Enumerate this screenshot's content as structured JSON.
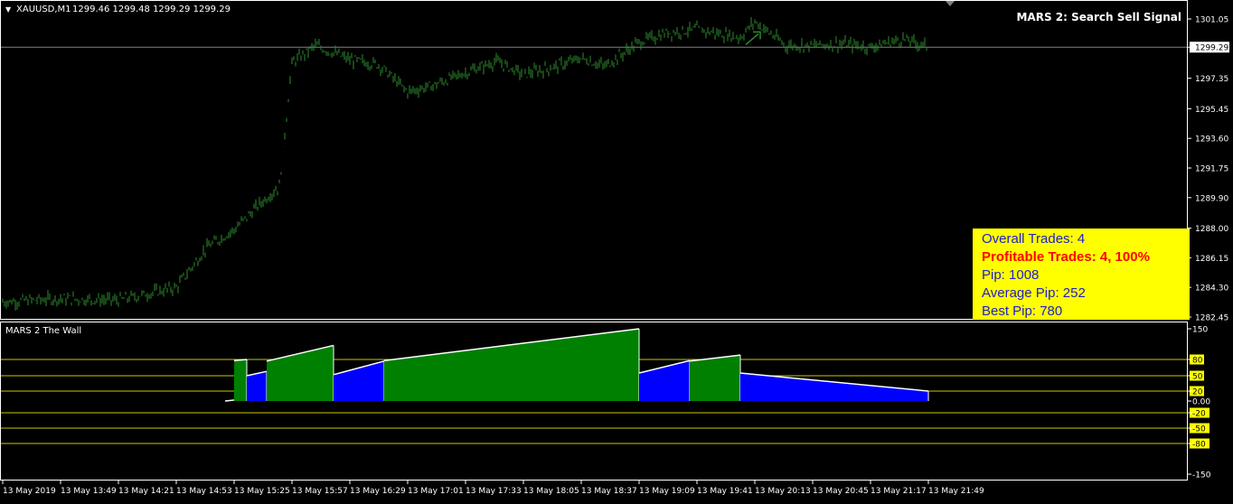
{
  "header": {
    "symbol": "XAUUSD,M1",
    "ohlc": "1299.46 1299.48 1299.29 1299.29",
    "signal_title": "MARS 2: Search Sell Signal",
    "current_price_label": "1299.29"
  },
  "info_box": {
    "lines": [
      {
        "text": "Overall Trades: 4",
        "highlight": false
      },
      {
        "text": "Profitable Trades: 4, 100%",
        "highlight": true
      },
      {
        "text": "Pip: 1008",
        "highlight": false
      },
      {
        "text": "Average Pip: 252",
        "highlight": false
      },
      {
        "text": "Best Pip: 780",
        "highlight": false
      }
    ],
    "background": "#ffff00",
    "text_color": "#2020c8",
    "highlight_color": "#ff0000"
  },
  "indicator": {
    "name": "MARS 2 The Wall"
  },
  "colors": {
    "price_line": "#2e8b2e",
    "histogram_green": "#008000",
    "histogram_blue": "#0000ff",
    "level_line": "#c8c800",
    "level_label_bg": "#ffff00",
    "current_price_line": "#808080"
  },
  "chart_data": [
    {
      "type": "line",
      "title": "",
      "xlabel": "",
      "ylabel": "",
      "ylim": [
        1282.45,
        1301.05
      ],
      "y_ticks": [
        "1301.05",
        "1299.29",
        "1297.35",
        "1295.45",
        "1293.60",
        "1291.75",
        "1289.90",
        "1288.00",
        "1286.15",
        "1284.30",
        "1282.45"
      ],
      "x_ticks": [
        "13 May 2019",
        "13 May 13:49",
        "13 May 14:21",
        "13 May 14:53",
        "13 May 15:25",
        "13 May 15:57",
        "13 May 16:29",
        "13 May 17:01",
        "13 May 17:33",
        "13 May 18:05",
        "13 May 18:37",
        "13 May 19:09",
        "13 May 19:41",
        "13 May 20:13",
        "13 May 20:45",
        "13 May 21:17",
        "13 May 21:49"
      ],
      "current_price": 1299.29,
      "series": [
        {
          "x": [
            "13 May 2019",
            "13 May 13:49",
            "13 May 14:21",
            "13 May 14:53",
            "13 May 15:10",
            "13 May 15:25",
            "13 May 15:40",
            "13 May 15:50",
            "13 May 15:57",
            "13 May 16:10",
            "13 May 16:29",
            "13 May 16:45",
            "13 May 17:01",
            "13 May 17:15",
            "13 May 17:33",
            "13 May 17:50",
            "13 May 18:05",
            "13 May 18:20",
            "13 May 18:37",
            "13 May 18:50",
            "13 May 19:09",
            "13 May 19:25",
            "13 May 19:41",
            "13 May 19:55",
            "13 May 20:05",
            "13 May 20:13",
            "13 May 20:30",
            "13 May 20:45",
            "13 May 21:00",
            "13 May 21:17",
            "13 May 21:35",
            "13 May 21:49"
          ],
          "values": [
            1283.4,
            1283.6,
            1283.5,
            1284.3,
            1286.8,
            1287.9,
            1289.6,
            1290.6,
            1298.3,
            1299.4,
            1298.5,
            1298.2,
            1296.5,
            1296.9,
            1297.7,
            1298.4,
            1297.6,
            1298.0,
            1298.6,
            1298.1,
            1299.6,
            1300.2,
            1300.4,
            1300.1,
            1299.9,
            1300.9,
            1299.4,
            1299.4,
            1299.5,
            1299.3,
            1299.8,
            1299.3
          ]
        }
      ]
    },
    {
      "type": "area",
      "title": "MARS 2 The Wall",
      "ylim": [
        -150,
        150
      ],
      "y_ticks": [
        "150",
        "80",
        "50",
        "20",
        "0.00",
        "-20",
        "-50",
        "-80",
        "-150"
      ],
      "levels": [
        80,
        50,
        20,
        -20,
        -50,
        -80
      ],
      "series": [
        {
          "name": "",
          "segments": [
            {
              "color": "green",
              "from": "13 May 15:25",
              "to": "13 May 15:32",
              "values": [
                78,
                80
              ]
            },
            {
              "color": "blue",
              "from": "13 May 15:32",
              "to": "13 May 15:43",
              "values": [
                50,
                58
              ]
            },
            {
              "color": "green",
              "from": "13 May 15:43",
              "to": "13 May 16:20",
              "values": [
                77,
                112
              ]
            },
            {
              "color": "blue",
              "from": "13 May 16:20",
              "to": "13 May 16:48",
              "values": [
                52,
                77
              ]
            },
            {
              "color": "green",
              "from": "13 May 16:48",
              "to": "13 May 19:09",
              "values": [
                78,
                150
              ]
            },
            {
              "color": "blue",
              "from": "13 May 19:09",
              "to": "13 May 19:37",
              "values": [
                55,
                78
              ]
            },
            {
              "color": "green",
              "from": "13 May 19:37",
              "to": "13 May 20:05",
              "values": [
                77,
                90
              ]
            },
            {
              "color": "blue",
              "from": "13 May 20:05",
              "to": "13 May 21:49",
              "values": [
                55,
                20
              ]
            }
          ]
        }
      ]
    }
  ]
}
